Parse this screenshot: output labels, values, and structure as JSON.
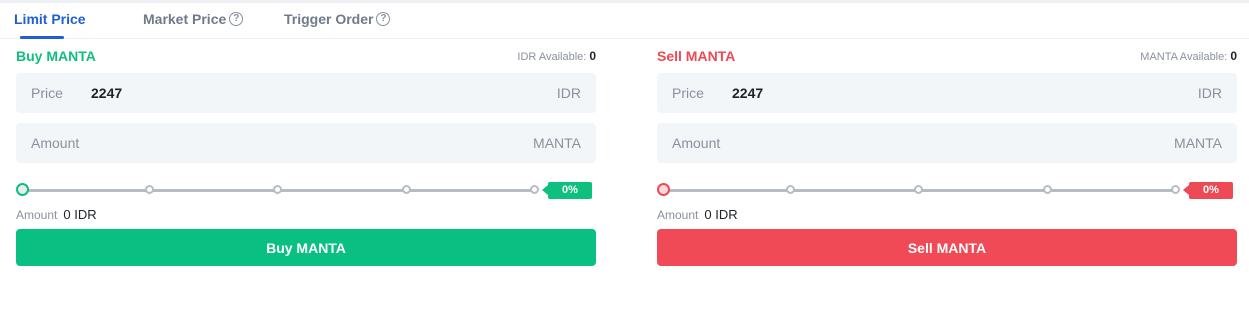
{
  "tabs": [
    {
      "label": "Limit Price",
      "active": true,
      "help": false
    },
    {
      "label": "Market Price",
      "active": false,
      "help": true
    },
    {
      "label": "Trigger Order",
      "active": false,
      "help": true
    }
  ],
  "buy": {
    "title": "Buy MANTA",
    "available_label": "IDR Available:",
    "available_value": "0",
    "price_label": "Price",
    "price_value": "2247",
    "price_unit": "IDR",
    "amount_placeholder": "Amount",
    "amount_unit": "MANTA",
    "slider_percent": "0%",
    "total_label": "Amount",
    "total_value": "0 IDR",
    "button_label": "Buy MANTA"
  },
  "sell": {
    "title": "Sell MANTA",
    "available_label": "MANTA Available:",
    "available_value": "0",
    "price_label": "Price",
    "price_value": "2247",
    "price_unit": "IDR",
    "amount_placeholder": "Amount",
    "amount_unit": "MANTA",
    "slider_percent": "0%",
    "total_label": "Amount",
    "total_value": "0 IDR",
    "button_label": "Sell MANTA"
  },
  "colors": {
    "accent": "#1f5fd6",
    "buy": "#0abf82",
    "sell": "#ef4a56"
  },
  "icons": {
    "help": "question-circle-icon"
  }
}
